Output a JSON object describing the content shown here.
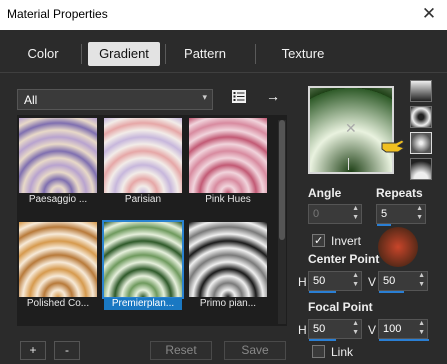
{
  "window": {
    "title": "Material Properties",
    "close": "✕"
  },
  "tabs": [
    {
      "label": "Color"
    },
    {
      "label": "Gradient"
    },
    {
      "label": "Pattern"
    },
    {
      "label": "Texture"
    }
  ],
  "category": {
    "value": "All"
  },
  "gallery": [
    {
      "name": "Paesaggio ...",
      "colors": [
        "#b8a3cf",
        "#e8d9c8",
        "#7f6fb0"
      ]
    },
    {
      "name": "Parisian",
      "colors": [
        "#c7b7dc",
        "#f2ece8",
        "#e6a7a7"
      ]
    },
    {
      "name": "Pink Hues",
      "colors": [
        "#c25a75",
        "#f1d4dc",
        "#d88ba0"
      ]
    },
    {
      "name": "Polished Co...",
      "colors": [
        "#d69a4e",
        "#f7ead8",
        "#b87a3a"
      ]
    },
    {
      "name": "Premierplan...",
      "colors": [
        "#2f5a2a",
        "#e6f0dc",
        "#6f9a5e"
      ],
      "selected": true
    },
    {
      "name": "Primo pian...",
      "colors": [
        "#1a1a1a",
        "#f0f0f0",
        "#7a7a7a"
      ]
    }
  ],
  "buttons": {
    "add": "+",
    "remove": "-",
    "reset": "Reset",
    "save": "Save"
  },
  "gradient": {
    "angle_label": "Angle",
    "angle_value": "0",
    "repeats_label": "Repeats",
    "repeats_value": "5",
    "invert_label": "Invert",
    "invert_checked": true,
    "center_label": "Center Point",
    "center_h_label": "H",
    "center_h": "50",
    "center_v_label": "V",
    "center_v": "50",
    "focal_label": "Focal Point",
    "focal_h_label": "H",
    "focal_h": "50",
    "focal_v_label": "V",
    "focal_v": "100",
    "link_label": "Link",
    "link_checked": false
  },
  "icons": {
    "category_chevron": "▾",
    "book": "book-icon",
    "arrow": "→",
    "check": "✓",
    "up": "▲",
    "down": "▼"
  },
  "colors": {
    "accent": "#1a78c2",
    "preview_green": "#2f5a2a"
  }
}
